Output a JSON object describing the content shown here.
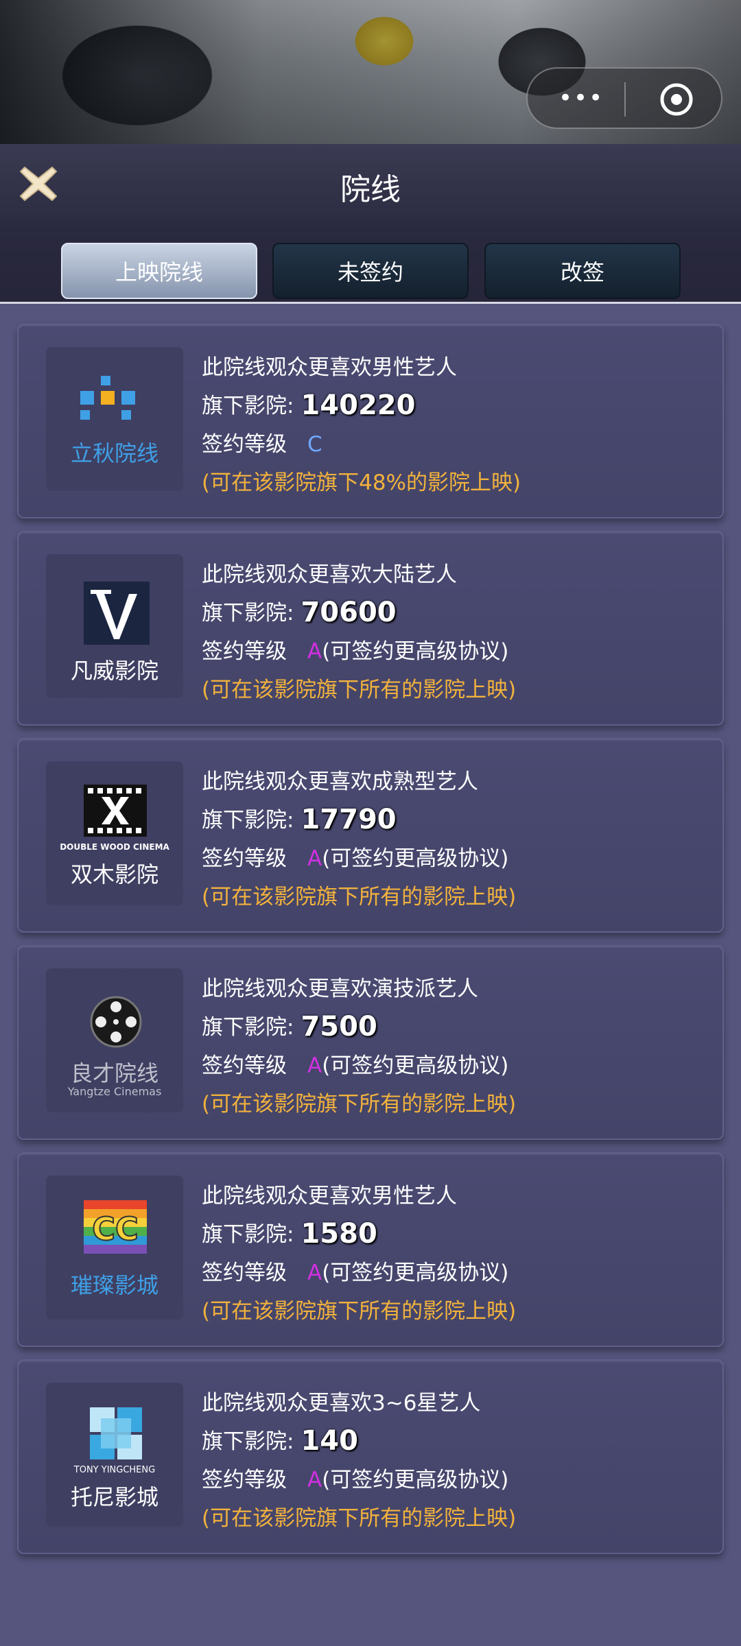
{
  "header": {
    "title": "院线"
  },
  "tabs": [
    {
      "label": "上映院线",
      "active": true
    },
    {
      "label": "未签约",
      "active": false
    },
    {
      "label": "改签",
      "active": false
    }
  ],
  "colors": {
    "grade_c": "#6fa8ff",
    "grade_a": "#d030e0",
    "note": "#f2b23c"
  },
  "cinemas": [
    {
      "logo_name": "立秋院线",
      "logo_sub": "",
      "preference": "此院线观众更喜欢男性艺人",
      "count_label": "旗下影院:",
      "count": "140220",
      "grade_label": "签约等级",
      "grade": "C",
      "grade_note": "",
      "note": "(可在该影院旗下48%的影院上映)"
    },
    {
      "logo_name": "凡威影院",
      "logo_sub": "",
      "preference": "此院线观众更喜欢大陆艺人",
      "count_label": "旗下影院:",
      "count": "70600",
      "grade_label": "签约等级",
      "grade": "A",
      "grade_note": "(可签约更高级协议)",
      "note": "(可在该影院旗下所有的影院上映)"
    },
    {
      "logo_name": "双木影院",
      "logo_sub": "DOUBLE WOOD CINEMA",
      "preference": "此院线观众更喜欢成熟型艺人",
      "count_label": "旗下影院:",
      "count": "17790",
      "grade_label": "签约等级",
      "grade": "A",
      "grade_note": "(可签约更高级协议)",
      "note": "(可在该影院旗下所有的影院上映)"
    },
    {
      "logo_name": "良才院线",
      "logo_sub": "Yangtze Cinemas",
      "preference": "此院线观众更喜欢演技派艺人",
      "count_label": "旗下影院:",
      "count": "7500",
      "grade_label": "签约等级",
      "grade": "A",
      "grade_note": "(可签约更高级协议)",
      "note": "(可在该影院旗下所有的影院上映)"
    },
    {
      "logo_name": "璀璨影城",
      "logo_sub": "",
      "preference": "此院线观众更喜欢男性艺人",
      "count_label": "旗下影院:",
      "count": "1580",
      "grade_label": "签约等级",
      "grade": "A",
      "grade_note": "(可签约更高级协议)",
      "note": "(可在该影院旗下所有的影院上映)"
    },
    {
      "logo_name": "托尼影城",
      "logo_sub": "TONY YINGCHENG",
      "preference": "此院线观众更喜欢3~6星艺人",
      "count_label": "旗下影院:",
      "count": "140",
      "grade_label": "签约等级",
      "grade": "A",
      "grade_note": "(可签约更高级协议)",
      "note": "(可在该影院旗下所有的影院上映)"
    }
  ]
}
